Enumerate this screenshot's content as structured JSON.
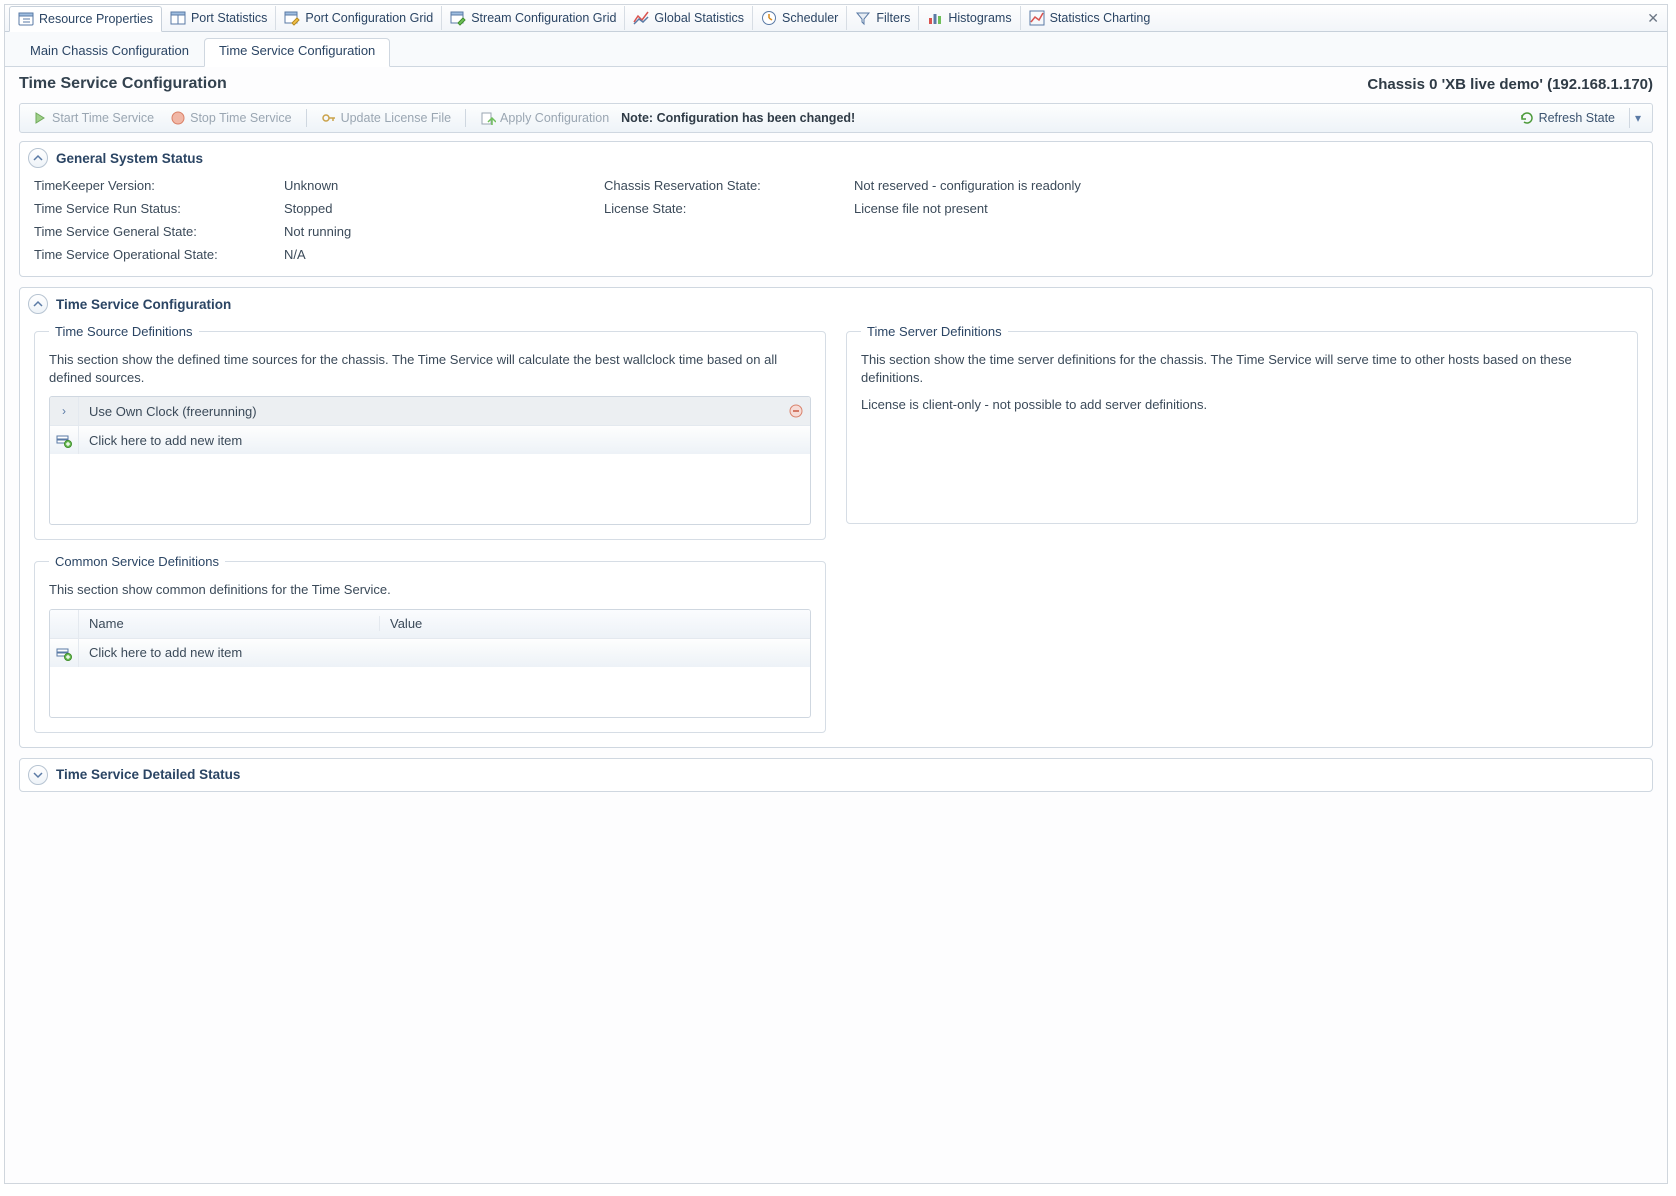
{
  "top_tabs": {
    "resource_properties": "Resource Properties",
    "port_statistics": "Port Statistics",
    "port_config_grid": "Port Configuration Grid",
    "stream_config_grid": "Stream Configuration Grid",
    "global_statistics": "Global Statistics",
    "scheduler": "Scheduler",
    "filters": "Filters",
    "histograms": "Histograms",
    "statistics_charting": "Statistics Charting"
  },
  "sub_tabs": {
    "main_chassis": "Main Chassis Configuration",
    "time_service": "Time Service Configuration"
  },
  "page": {
    "title": "Time Service Configuration",
    "context": "Chassis 0 'XB live demo' (192.168.1.170)"
  },
  "toolbar": {
    "start": "Start Time Service",
    "stop": "Stop Time Service",
    "update_license": "Update License File",
    "apply_config": "Apply Configuration",
    "note": "Note: Configuration has been changed!",
    "refresh": "Refresh State"
  },
  "status_panel": {
    "title": "General System Status",
    "labels": {
      "tk_version": "TimeKeeper Version:",
      "run_status": "Time Service Run Status:",
      "general_state": "Time Service General State:",
      "op_state": "Time Service Operational State:",
      "reservation": "Chassis Reservation State:",
      "license": "License State:"
    },
    "values": {
      "tk_version": "Unknown",
      "run_status": "Stopped",
      "general_state": "Not running",
      "op_state": "N/A",
      "reservation": "Not reserved - configuration is readonly",
      "license": "License file not present"
    }
  },
  "config_panel": {
    "title": "Time Service Configuration",
    "time_source": {
      "legend": "Time Source Definitions",
      "desc": "This section show the defined time sources for the chassis. The Time Service will calculate the best wallclock time based on all defined sources.",
      "item0": "Use Own Clock (freerunning)",
      "add_new": "Click here to add new item"
    },
    "time_server": {
      "legend": "Time Server Definitions",
      "desc": "This section show the time server definitions for the chassis. The Time Service will serve time to other hosts based on these definitions.",
      "note": "License is client-only - not possible to add server definitions."
    },
    "common": {
      "legend": "Common Service Definitions",
      "desc": "This section show common definitions for the Time Service.",
      "col_name": "Name",
      "col_value": "Value",
      "add_new": "Click here to add new item"
    }
  },
  "detailed_panel": {
    "title": "Time Service Detailed Status"
  }
}
